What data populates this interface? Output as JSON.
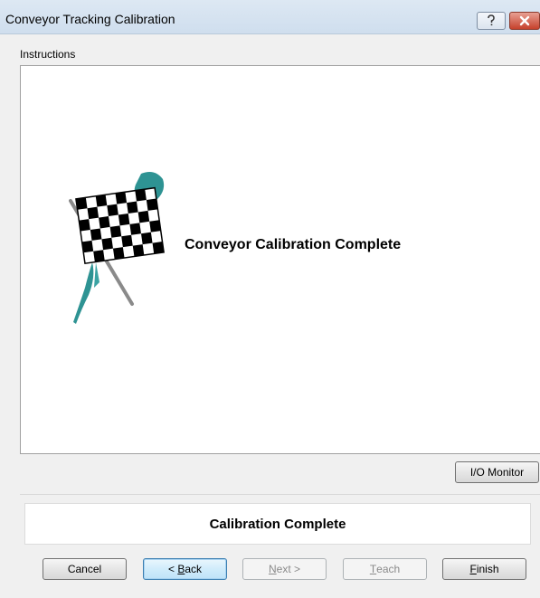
{
  "window": {
    "title": "Conveyor Tracking Calibration",
    "help_icon": "help-question-icon",
    "close_icon": "close-x-icon"
  },
  "instructions": {
    "label": "Instructions",
    "message": "Conveyor Calibration Complete",
    "image_icon": "checkered-flag-icon"
  },
  "io_monitor": {
    "label": "I/O Monitor"
  },
  "status": {
    "text": "Calibration Complete"
  },
  "buttons": {
    "cancel": "Cancel",
    "back_arrow": "<",
    "back_mnemonic": "B",
    "back_rest": "ack",
    "next_mnemonic": "N",
    "next_rest": "ext",
    "next_arrow": ">",
    "teach_mnemonic": "T",
    "teach_rest": "each",
    "finish_mnemonic": "F",
    "finish_rest": "inish"
  },
  "colors": {
    "titlebar": "#dde8f3",
    "close_button": "#c6412c",
    "flag_splash": "#2e9393"
  }
}
